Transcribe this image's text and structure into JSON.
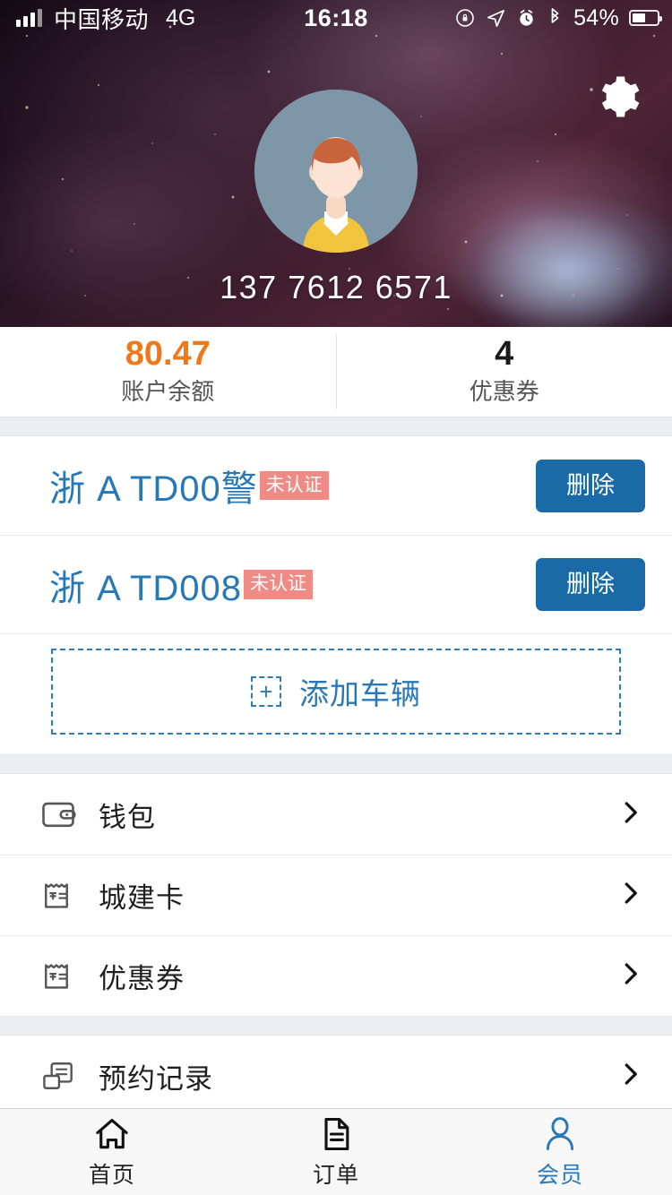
{
  "status_bar": {
    "carrier": "中国移动",
    "network": "4G",
    "time": "16:18",
    "battery_percent": "54%",
    "icons": [
      "signal-bars-icon",
      "rotation-lock-icon",
      "location-arrow-icon",
      "alarm-clock-icon",
      "bluetooth-icon",
      "battery-icon"
    ]
  },
  "header": {
    "phone_number": "137 7612 6571",
    "settings_icon": "gear-icon",
    "avatar_icon": "user-avatar",
    "background": "galaxy-nebula-photo"
  },
  "stats": [
    {
      "value": "80.47",
      "label": "账户余额",
      "color": "#f07818"
    },
    {
      "value": "4",
      "label": "优惠券",
      "color": "#1a1a1a"
    }
  ],
  "vehicles": {
    "items": [
      {
        "plate": "浙 A TD00警",
        "badge": "未认证",
        "action_label": "删除"
      },
      {
        "plate": "浙 A TD008",
        "badge": "未认证",
        "action_label": "删除"
      }
    ],
    "add_label": "添加车辆",
    "add_icon": "plus-icon",
    "badge_color": "#f08a85",
    "plate_color": "#2878b8",
    "delete_button_color": "#1a6aa8"
  },
  "menu_group_1": [
    {
      "label": "钱包",
      "icon": "wallet-icon"
    },
    {
      "label": "城建卡",
      "icon": "voucher-card-icon"
    },
    {
      "label": "优惠券",
      "icon": "coupon-icon"
    }
  ],
  "menu_group_2": [
    {
      "label": "预约记录",
      "icon": "reservation-record-icon"
    }
  ],
  "tabbar": {
    "items": [
      {
        "label": "首页",
        "icon": "home-icon",
        "active": false
      },
      {
        "label": "订单",
        "icon": "document-icon",
        "active": false
      },
      {
        "label": "会员",
        "icon": "person-icon",
        "active": true
      }
    ],
    "active_color": "#2878b8"
  }
}
